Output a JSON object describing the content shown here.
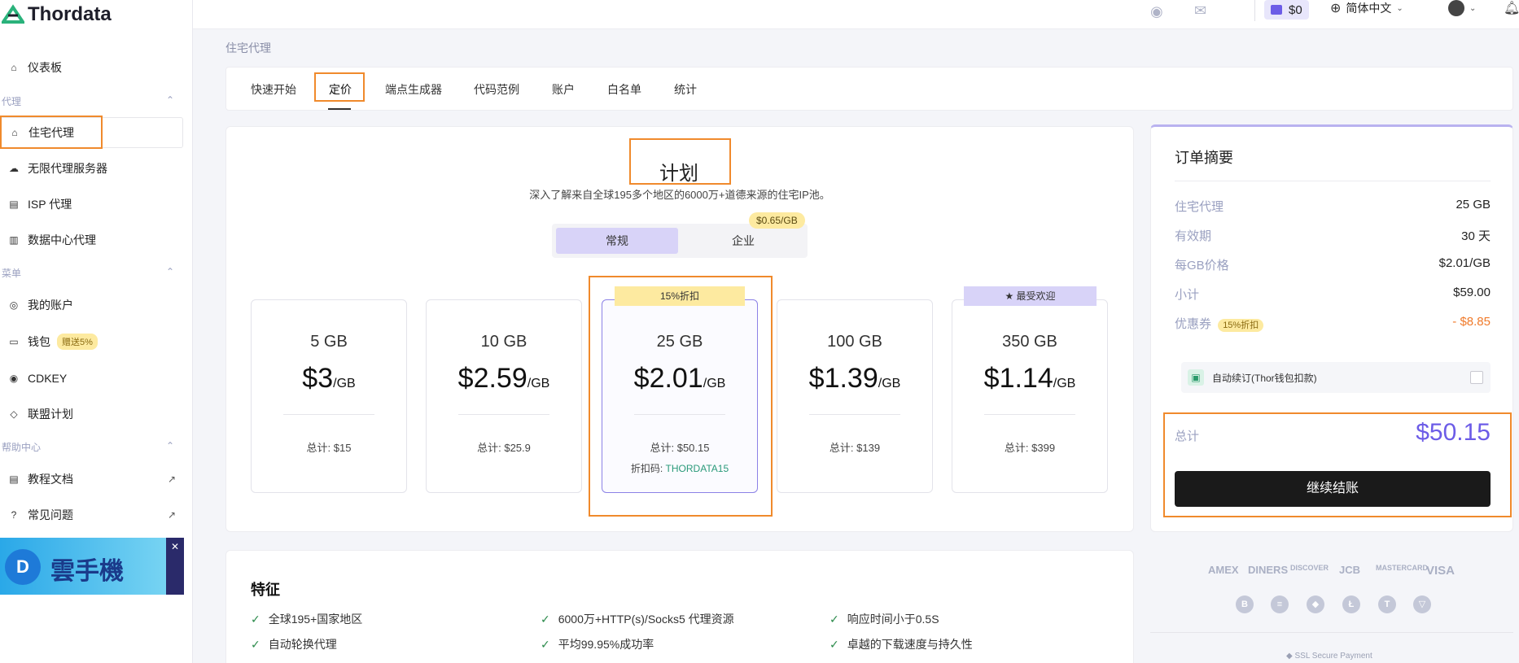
{
  "app": {
    "logo_text": "Thordata"
  },
  "topbar": {
    "balance": "$0",
    "language": "简体中文"
  },
  "sidebar": {
    "dashboard": "仪表板",
    "section_proxy": "代理",
    "residential": "住宅代理",
    "unlimited": "无限代理服务器",
    "isp": "ISP 代理",
    "datacenter": "数据中心代理",
    "section_menu": "菜单",
    "account": "我的账户",
    "wallet": "钱包",
    "wallet_badge": "赠送5%",
    "cdkey": "CDKEY",
    "affiliate": "联盟计划",
    "section_help": "帮助中心",
    "docs": "教程文档",
    "faq": "常见问题",
    "banner_text": "雲手機"
  },
  "breadcrumb": "住宅代理",
  "tabs": [
    "快速开始",
    "定价",
    "端点生成器",
    "代码范例",
    "账户",
    "白名单",
    "统计"
  ],
  "plan": {
    "title": "计划",
    "subtitle": "深入了解来自全球195多个地区的6000万+道德来源的住宅IP池。",
    "toggle_regular": "常规",
    "toggle_enterprise": "企业",
    "enterprise_badge": "$0.65/GB"
  },
  "cards": [
    {
      "gb": "5 GB",
      "price": "$3",
      "unit": "/GB",
      "total": "总计: $15"
    },
    {
      "gb": "10 GB",
      "price": "$2.59",
      "unit": "/GB",
      "total": "总计: $25.9"
    },
    {
      "gb": "25 GB",
      "price": "$2.01",
      "unit": "/GB",
      "total": "总计: $50.15",
      "ribbon": "15%折扣",
      "promo_label": "折扣码:",
      "promo_code": "THORDATA15"
    },
    {
      "gb": "100 GB",
      "price": "$1.39",
      "unit": "/GB",
      "total": "总计: $139"
    },
    {
      "gb": "350 GB",
      "price": "$1.14",
      "unit": "/GB",
      "total": "总计: $399",
      "ribbon": "★ 最受欢迎"
    }
  ],
  "features": {
    "title": "特征",
    "items": [
      "全球195+国家地区",
      "6000万+HTTP(s)/Socks5 代理资源",
      "响应时间小于0.5S",
      "自动轮换代理",
      "平均99.95%成功率",
      "卓越的下载速度与持久性"
    ]
  },
  "summary": {
    "title": "订单摘要",
    "rows": [
      {
        "k": "住宅代理",
        "v": "25 GB"
      },
      {
        "k": "有效期",
        "v": "30 天"
      },
      {
        "k": "每GB价格",
        "v": "$2.01/GB"
      },
      {
        "k": "小计",
        "v": "$59.00"
      },
      {
        "k": "优惠券",
        "badge": "15%折扣",
        "v": "- $8.85"
      }
    ],
    "auto_renew": "自动续订(Thor钱包扣款)",
    "total_label": "总计",
    "total_value": "$50.15",
    "checkout": "继续结账",
    "secure": "SSL Secure Payment",
    "payment_methods": [
      "AMEX",
      "DINERS",
      "DISCOVER",
      "JCB",
      "MASTERCARD",
      "VISA"
    ],
    "coins": [
      "B",
      "≡",
      "◆",
      "Ł",
      "T",
      "▽"
    ]
  },
  "colors": {
    "accent": "#6c5ce7",
    "highlight_orange": "#f08a2c",
    "discount_orange": "#f07a2a"
  }
}
